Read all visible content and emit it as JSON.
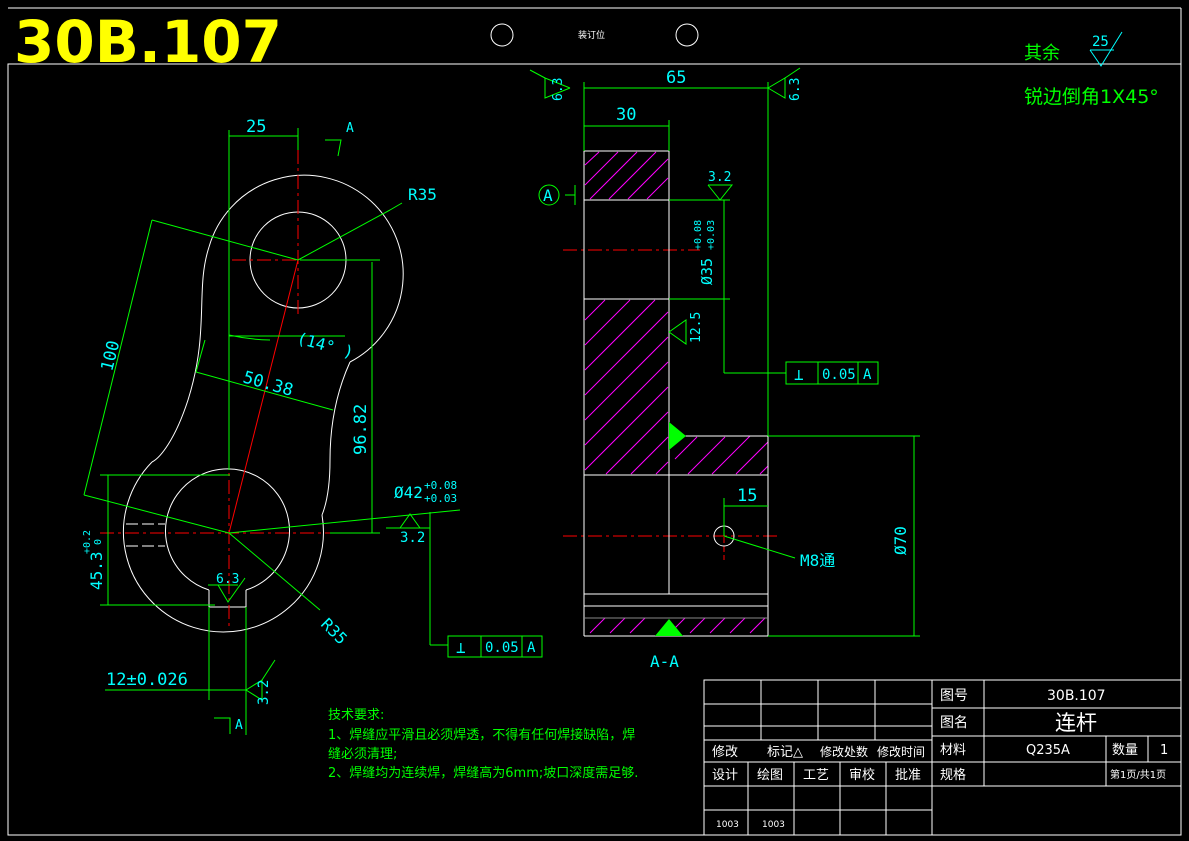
{
  "drawing_number": "30B.107",
  "binding_label": "装订位",
  "surface_note": {
    "label": "其余",
    "value": "25"
  },
  "edge_note": "锐边倒角1X45°",
  "dims": {
    "d25": "25",
    "sec_a": "A",
    "r35_top": "R35",
    "d100": "100",
    "angle": "(14° )",
    "d5038": "50.38",
    "d9682": "96.82",
    "bore": "Ø42",
    "bore_tol_up": "+0.08",
    "bore_tol_dn": "+0.03",
    "rough32_left": "3.2",
    "d453": "45.3",
    "d453_tol_up": "+0.2",
    "d453_tol_dn": "0",
    "rough63_key": "6.3",
    "r35_bot": "R35",
    "perp_left_sym": "⊥",
    "perp_left_val": "0.05",
    "perp_left_ref": "A",
    "d12": "12±0.026",
    "rough32_bottom": "3.2",
    "sec_a_bottom": "A",
    "d65": "65",
    "d30": "30",
    "rough63_l": "6.3",
    "rough63_r": "6.3",
    "datum_a": "A",
    "rough32_right": "3.2",
    "bore_r": "Ø35",
    "bore_r_tol_up": "+0.08",
    "bore_r_tol_dn": "+0.03",
    "rough125": "12.5",
    "perp_right_sym": "⊥",
    "perp_right_val": "0.05",
    "perp_right_ref": "A",
    "d15": "15",
    "m8": "M8通",
    "d70": "Ø70",
    "section_label": "A-A"
  },
  "tech": {
    "title": "技术要求:",
    "line1": "1、焊缝应平滑且必须焊透，不得有任何焊接缺陷，焊",
    "line2": "缝必须清理;",
    "line3": "2、焊缝均为连续焊，焊缝高为6mm;坡口深度需足够."
  },
  "titleblock": {
    "tuhao_label": "图号",
    "tuhao_value": "30B.107",
    "tuming_label": "图名",
    "tuming_value": "连杆",
    "cailiao_label": "材料",
    "cailiao_value": "Q235A",
    "shuliang_label": "数量",
    "shuliang_value": "1",
    "guige_label": "规格",
    "page_info": "第1页/共1页",
    "rev_headers": [
      "修改",
      "标记△",
      "修改处数",
      "修改时间"
    ],
    "sign_headers": [
      "设计",
      "绘图",
      "工艺",
      "审校",
      "批准"
    ],
    "sign_values": [
      "1003",
      "1003"
    ]
  },
  "colors": {
    "frame": "#ffffff",
    "dim": "#00ff00",
    "text": "#00ffff",
    "title": "#ffff00",
    "center": "#ff0000",
    "hatch": "#ff00ff"
  }
}
